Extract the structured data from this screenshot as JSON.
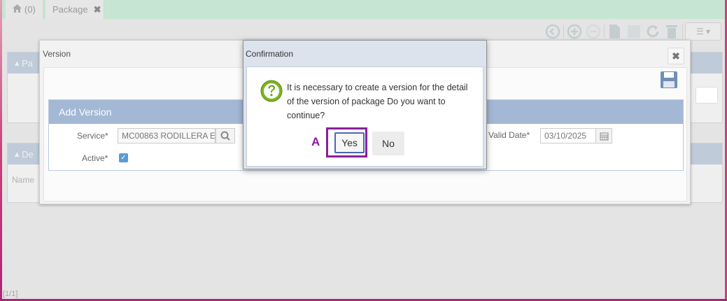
{
  "tabs": [
    {
      "label": "(0)",
      "icon": "home-icon"
    },
    {
      "label": "Package",
      "close": "✖"
    }
  ],
  "toolbar": {
    "icons": [
      "back-icon",
      "add-icon",
      "remove-icon",
      "new-document-icon",
      "save-icon",
      "refresh-icon",
      "delete-icon",
      "list-menu-icon"
    ]
  },
  "background": {
    "panel1_label": "Pa",
    "panel2_label": "De",
    "column_name": "Name",
    "status": "[1/1]"
  },
  "version_dialog": {
    "title": "Version",
    "close": "✖",
    "section_title": "Add Version",
    "service_label": "Service*",
    "service_value": "MC00863 RODILLERA E",
    "valid_date_label": "Valid Date*",
    "valid_date_value": "03/10/2025",
    "active_label": "Active*",
    "active_checked": true
  },
  "confirm_dialog": {
    "title": "Confirmation",
    "message": "It is necessary to create a version for the detail of the version of package Do you want to continue?",
    "yes_label": "Yes",
    "no_label": "No"
  },
  "annotation": {
    "label": "A",
    "color": "#8b1e9c"
  },
  "colors": {
    "tabbar": "#c6e6d3",
    "section_header": "#a3b8d4",
    "dialog_header": "#dce3ed"
  }
}
